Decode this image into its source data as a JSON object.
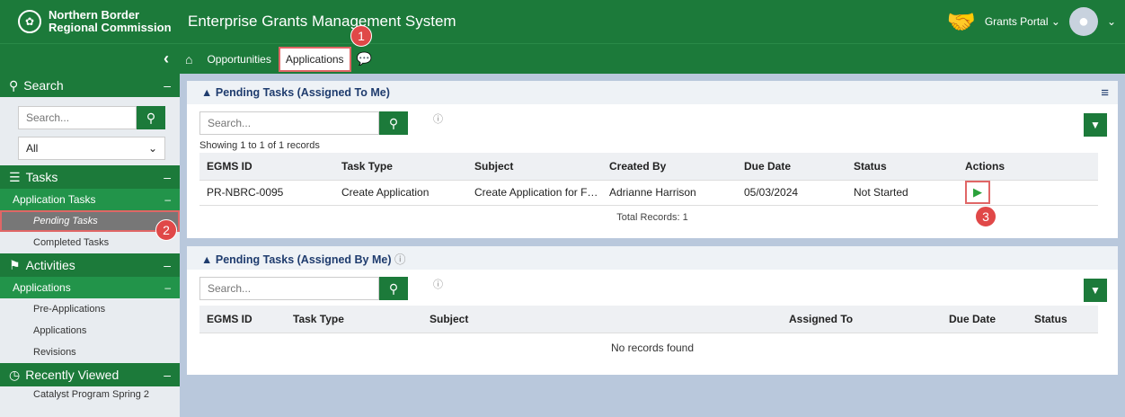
{
  "header": {
    "org_line1": "Northern Border",
    "org_line2": "Regional Commission",
    "app_title": "Enterprise Grants Management System",
    "portal_label": "Grants Portal"
  },
  "nav": {
    "tabs": [
      {
        "label": "Opportunities"
      },
      {
        "label": "Applications"
      }
    ]
  },
  "sidebar": {
    "search_title": "Search",
    "search_placeholder": "Search...",
    "filter_value": "All",
    "tasks_title": "Tasks",
    "application_tasks": "Application Tasks",
    "pending_tasks": "Pending Tasks",
    "completed_tasks": "Completed Tasks",
    "activities_title": "Activities",
    "applications_sub": "Applications",
    "items": [
      "Pre-Applications",
      "Applications",
      "Revisions"
    ],
    "recent_title": "Recently Viewed",
    "recent_item": "Catalyst Program Spring 2",
    "minus": "–"
  },
  "panel1": {
    "title": "Pending Tasks (Assigned To Me)",
    "search_placeholder": "Search...",
    "showing": "Showing 1 to 1 of 1 records",
    "columns": [
      "EGMS ID",
      "Task Type",
      "Subject",
      "Created By",
      "Due Date",
      "Status",
      "Actions"
    ],
    "row": {
      "id": "PR-NBRC-0095",
      "task_type": "Create Application",
      "subject": "Create Application for F…",
      "created_by": "Adrianne Harrison",
      "due_date": "05/03/2024",
      "status": "Not Started"
    },
    "total": "Total Records: 1"
  },
  "panel2": {
    "title": "Pending Tasks (Assigned By Me)",
    "search_placeholder": "Search...",
    "columns": [
      "EGMS ID",
      "Task Type",
      "Subject",
      "Assigned To",
      "Due Date",
      "Status"
    ],
    "empty": "No records found"
  },
  "badges": [
    "1",
    "2",
    "3"
  ],
  "colors": {
    "brand_green": "#1c7a3a",
    "annotation_red": "#e04848"
  }
}
